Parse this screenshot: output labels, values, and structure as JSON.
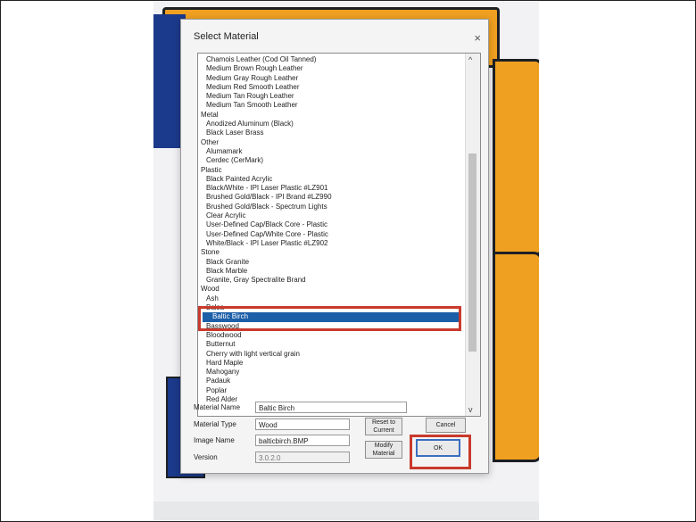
{
  "dialog": {
    "title": "Select Material",
    "close_glyph": "×"
  },
  "list": {
    "rows": [
      {
        "text": "Chamois Leather (Cod Oil Tanned)",
        "kind": "sub"
      },
      {
        "text": "Medium Brown Rough Leather",
        "kind": "sub"
      },
      {
        "text": "Medium Gray Rough Leather",
        "kind": "sub"
      },
      {
        "text": "Medium Red Smooth Leather",
        "kind": "sub"
      },
      {
        "text": "Medium Tan Rough Leather",
        "kind": "sub"
      },
      {
        "text": "Medium Tan Smooth Leather",
        "kind": "sub"
      },
      {
        "text": "Metal",
        "kind": "cat"
      },
      {
        "text": "Anodized Aluminum (Black)",
        "kind": "sub"
      },
      {
        "text": "Black Laser Brass",
        "kind": "sub"
      },
      {
        "text": "Other",
        "kind": "cat"
      },
      {
        "text": "Alumamark",
        "kind": "sub"
      },
      {
        "text": "Cerdec (CerMark)",
        "kind": "sub"
      },
      {
        "text": "Plastic",
        "kind": "cat"
      },
      {
        "text": "Black Painted Acrylic",
        "kind": "sub"
      },
      {
        "text": "Black/White - IPI Laser Plastic #LZ901",
        "kind": "sub"
      },
      {
        "text": "Brushed Gold/Black - IPI Brand #LZ990",
        "kind": "sub"
      },
      {
        "text": "Brushed Gold/Black - Spectrum Lights",
        "kind": "sub"
      },
      {
        "text": "Clear Acrylic",
        "kind": "sub"
      },
      {
        "text": "User-Defined Cap/Black Core - Plastic",
        "kind": "sub"
      },
      {
        "text": "User-Defined Cap/White Core - Plastic",
        "kind": "sub"
      },
      {
        "text": "White/Black - IPI Laser Plastic #LZ902",
        "kind": "sub"
      },
      {
        "text": "Stone",
        "kind": "cat"
      },
      {
        "text": "Black Granite",
        "kind": "sub"
      },
      {
        "text": "Black Marble",
        "kind": "sub"
      },
      {
        "text": "Granite, Gray Spectralite Brand",
        "kind": "sub"
      },
      {
        "text": "Wood",
        "kind": "cat"
      },
      {
        "text": "Ash",
        "kind": "sub"
      },
      {
        "text": "Balsa",
        "kind": "sub"
      },
      {
        "text": "Baltic Birch",
        "kind": "sel"
      },
      {
        "text": "Basswood",
        "kind": "sub"
      },
      {
        "text": "Bloodwood",
        "kind": "sub"
      },
      {
        "text": "Butternut",
        "kind": "sub"
      },
      {
        "text": "Cherry with light vertical grain",
        "kind": "sub"
      },
      {
        "text": "Hard Maple",
        "kind": "sub"
      },
      {
        "text": "Mahogany",
        "kind": "sub"
      },
      {
        "text": "Padauk",
        "kind": "sub"
      },
      {
        "text": "Poplar",
        "kind": "sub"
      },
      {
        "text": "Red Alder",
        "kind": "sub"
      }
    ],
    "scroll_up": "^",
    "scroll_down": "v"
  },
  "form": {
    "material_name_label": "Material Name",
    "material_name_value": "Baltic Birch",
    "material_type_label": "Material Type",
    "material_type_value": "Wood",
    "image_name_label": "Image Name",
    "image_name_value": "balticbirch.BMP",
    "version_label": "Version",
    "version_value": "3.0.2.0"
  },
  "buttons": {
    "reset": "Reset to Current",
    "modify": "Modify Material",
    "cancel": "Cancel",
    "ok": "OK"
  },
  "colors": {
    "selection": "#1c5fa8",
    "highlight": "#c83a2c",
    "accent_orange": "#f0a021",
    "accent_blue": "#1c3a8b"
  }
}
